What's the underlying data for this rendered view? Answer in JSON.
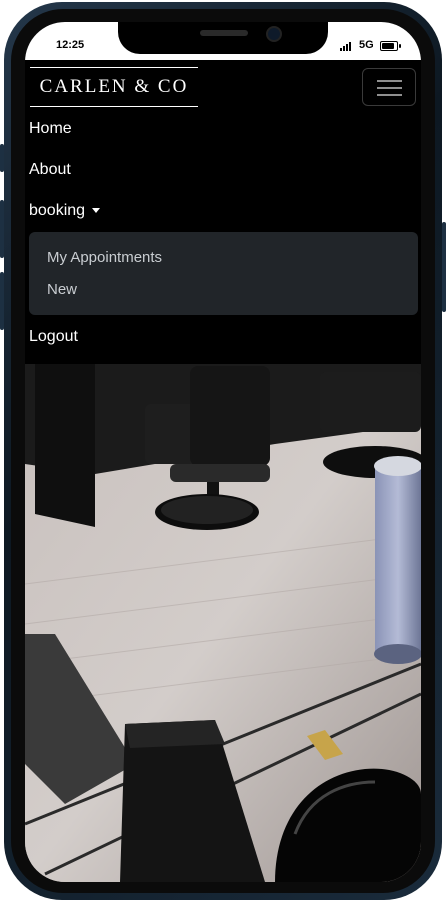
{
  "status_bar": {
    "time": "12:25",
    "network": "5G"
  },
  "brand": {
    "logo_text": "CARLEN & CO"
  },
  "nav": {
    "menu_toggle_icon": "hamburger-icon",
    "items": [
      {
        "label": "Home"
      },
      {
        "label": "About"
      },
      {
        "label": "booking"
      },
      {
        "label": "Logout"
      }
    ],
    "booking_dropdown": [
      {
        "label": "My Appointments"
      },
      {
        "label": "New"
      }
    ]
  },
  "colors": {
    "navbar_bg": "#000000",
    "dropdown_bg": "#212529",
    "dropdown_text": "#c9cdd1"
  }
}
